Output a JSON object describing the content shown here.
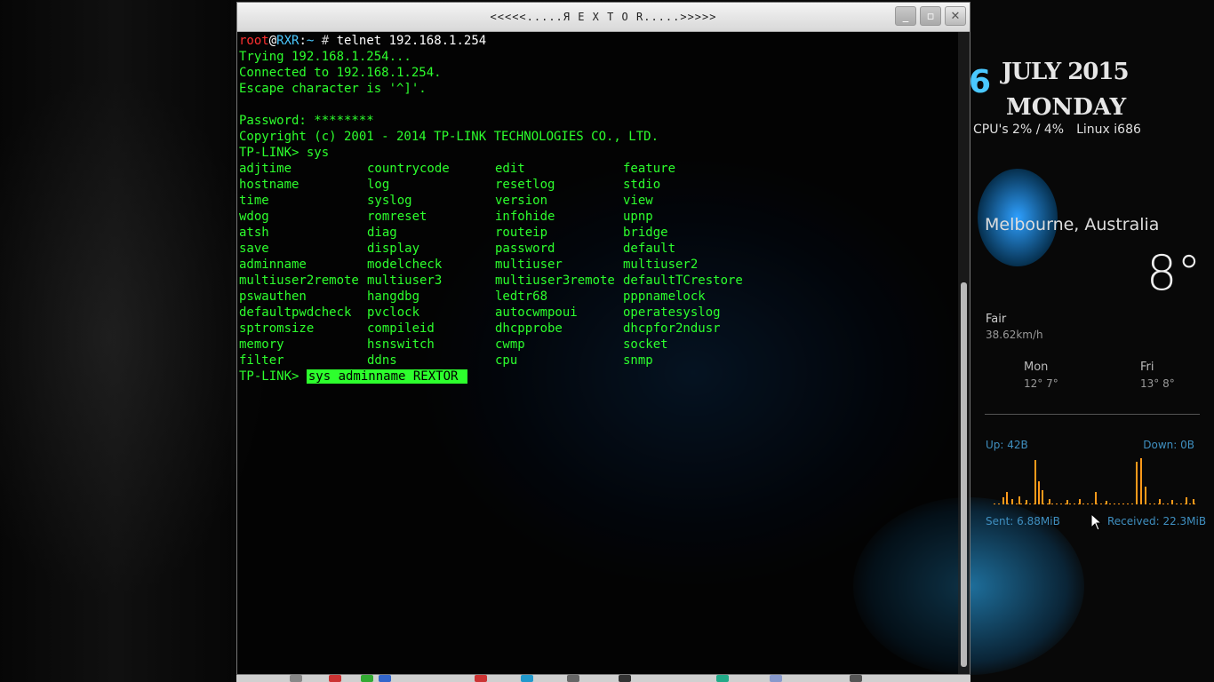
{
  "window": {
    "title": "<<<<<.....Я E X T O R.....>>>>>",
    "buttons": {
      "minimize": "_",
      "maximize": "▫",
      "close": "✕"
    }
  },
  "terminal": {
    "prompt": {
      "user": "root",
      "at": "@",
      "host": "RXR",
      "colon": ":",
      "path": "~",
      "hash": " # ",
      "command": "telnet 192.168.1.254"
    },
    "lines": [
      "Trying 192.168.1.254...",
      "Connected to 192.168.1.254.",
      "Escape character is '^]'.",
      "",
      "Password: ********",
      "Copyright (c) 2001 - 2014 TP-LINK TECHNOLOGIES CO., LTD.",
      "TP-LINK> sys"
    ],
    "commands": [
      [
        "adjtime",
        "countrycode",
        "edit",
        "feature"
      ],
      [
        "hostname",
        "log",
        "resetlog",
        "stdio"
      ],
      [
        "time",
        "syslog",
        "version",
        "view"
      ],
      [
        "wdog",
        "romreset",
        "infohide",
        "upnp"
      ],
      [
        "atsh",
        "diag",
        "routeip",
        "bridge"
      ],
      [
        "save",
        "display",
        "password",
        "default"
      ],
      [
        "adminname",
        "modelcheck",
        "multiuser",
        "multiuser2"
      ],
      [
        "multiuser2remote",
        "multiuser3",
        "multiuser3remote",
        "defaultTCrestore"
      ],
      [
        "pswauthen",
        "hangdbg",
        "ledtr68",
        "pppnamelock"
      ],
      [
        "defaultpwdcheck",
        "pvclock",
        "autocwmpoui",
        "operatesyslog"
      ],
      [
        "sptromsize",
        "compileid",
        "dhcpprobe",
        "dhcpfor2ndusr"
      ],
      [
        "memory",
        "hsnswitch",
        "cwmp",
        "socket"
      ],
      [
        "filter",
        "ddns",
        "cpu",
        "snmp"
      ]
    ],
    "final_prompt": "TP-LINK> ",
    "current_input": "sys adminname REXTOR "
  },
  "conky": {
    "date_digit": "6",
    "month_year": "JULY 2015",
    "day": "MONDAY",
    "cpu": "CPU's 2% / 4%",
    "os": "Linux i686",
    "location": "Melbourne, Australia",
    "temperature": "8°",
    "condition": "Fair",
    "wind": "38.62km/h",
    "forecast": [
      {
        "day": "Mon",
        "temps": "12° 7°"
      },
      {
        "day": "Fri",
        "temps": "13° 8°"
      }
    ],
    "net": {
      "up": "Up: 42B",
      "down": "Down: 0B",
      "sent": "Sent: 6.88MiB",
      "received": "Received: 22.3MiB"
    },
    "colors": {
      "accent": "#3f8fc0",
      "graph": "#ff9a1a",
      "term_green": "#2dff2d"
    }
  }
}
